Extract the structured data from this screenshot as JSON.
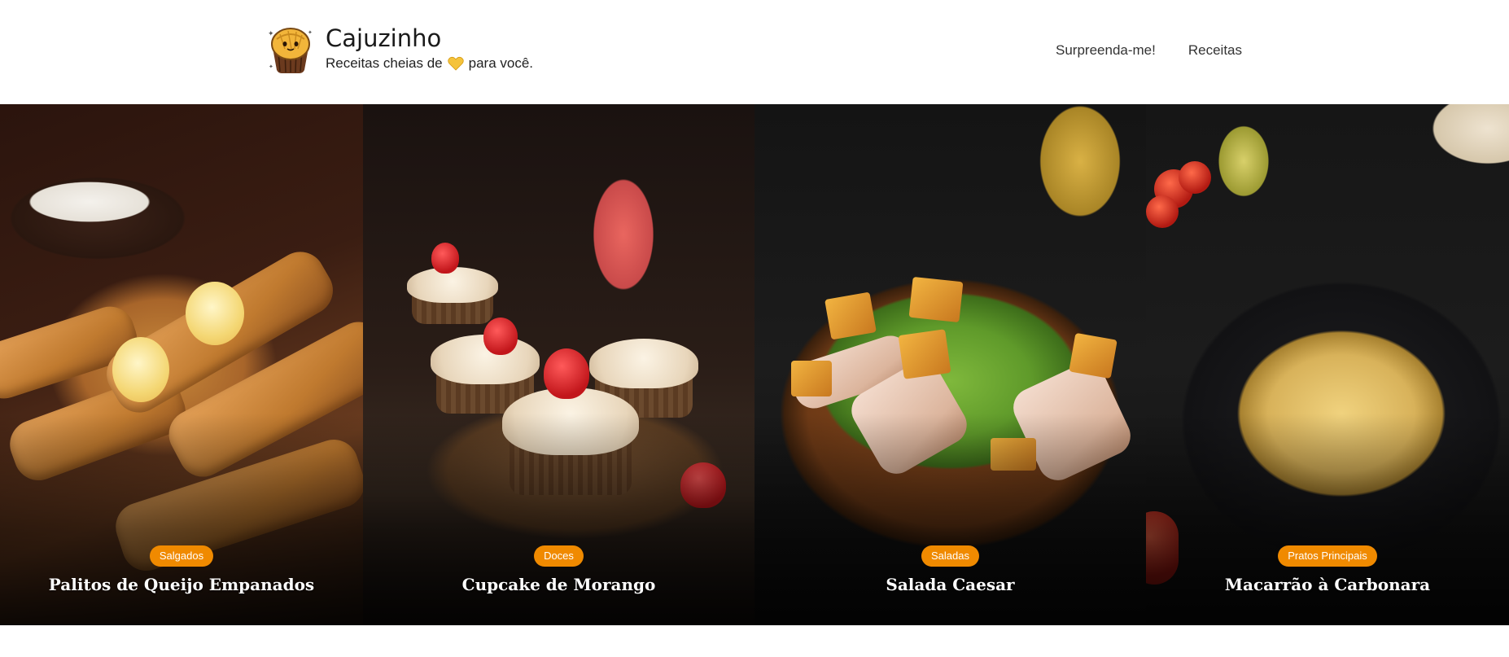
{
  "header": {
    "brand_name": "Cajuzinho",
    "tagline_before": "Receitas cheias de",
    "tagline_after": "para você.",
    "tagline_icon": "yellow-heart-icon",
    "logo_icon": "cajuzinho-mascot-icon"
  },
  "nav": {
    "items": [
      {
        "label": "Surpreenda-me!"
      },
      {
        "label": "Receitas"
      }
    ]
  },
  "cards": [
    {
      "category": "Salgados",
      "title": "Palitos de Queijo Empanados"
    },
    {
      "category": "Doces",
      "title": "Cupcake de Morango"
    },
    {
      "category": "Saladas",
      "title": "Salada Caesar"
    },
    {
      "category": "Pratos Principais",
      "title": "Macarrão à Carbonara"
    }
  ],
  "colors": {
    "badge": "#f08a00",
    "header_bg": "#ffffff"
  }
}
